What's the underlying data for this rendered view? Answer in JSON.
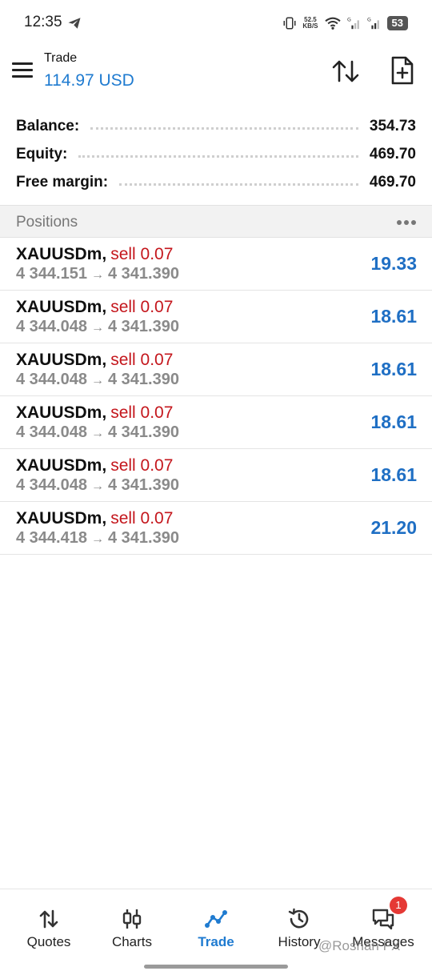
{
  "status_bar": {
    "time": "12:35",
    "speed_value": "52.5",
    "speed_unit": "KB/S",
    "battery": "53"
  },
  "header": {
    "title": "Trade",
    "balance": "114.97 USD"
  },
  "summary": {
    "rows": [
      {
        "label": "Balance:",
        "value": "354.73"
      },
      {
        "label": "Equity:",
        "value": "469.70"
      },
      {
        "label": "Free margin:",
        "value": "469.70"
      }
    ]
  },
  "positions": {
    "title": "Positions",
    "items": [
      {
        "symbol": "XAUUSDm",
        "side": "sell 0.07",
        "open": "4 344.151",
        "current": "4 341.390",
        "profit": "19.33"
      },
      {
        "symbol": "XAUUSDm",
        "side": "sell 0.07",
        "open": "4 344.048",
        "current": "4 341.390",
        "profit": "18.61"
      },
      {
        "symbol": "XAUUSDm",
        "side": "sell 0.07",
        "open": "4 344.048",
        "current": "4 341.390",
        "profit": "18.61"
      },
      {
        "symbol": "XAUUSDm",
        "side": "sell 0.07",
        "open": "4 344.048",
        "current": "4 341.390",
        "profit": "18.61"
      },
      {
        "symbol": "XAUUSDm",
        "side": "sell 0.07",
        "open": "4 344.048",
        "current": "4 341.390",
        "profit": "18.61"
      },
      {
        "symbol": "XAUUSDm",
        "side": "sell 0.07",
        "open": "4 344.418",
        "current": "4 341.390",
        "profit": "21.20"
      }
    ]
  },
  "nav": {
    "items": [
      {
        "label": "Quotes",
        "icon": "quotes-icon"
      },
      {
        "label": "Charts",
        "icon": "charts-icon"
      },
      {
        "label": "Trade",
        "icon": "trade-icon",
        "active": true
      },
      {
        "label": "History",
        "icon": "history-icon"
      },
      {
        "label": "Messages",
        "icon": "messages-icon",
        "badge": "1"
      }
    ]
  },
  "watermark": "@Roshan FX",
  "colors": {
    "accent": "#1f7bd0",
    "sell": "#c4161c",
    "profit": "#1f6fc4",
    "badge": "#e53935"
  }
}
